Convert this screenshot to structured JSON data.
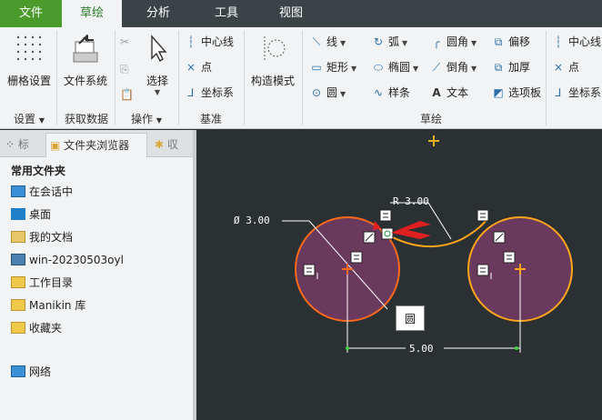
{
  "tabs": {
    "file": "文件",
    "sketch": "草绘",
    "analysis": "分析",
    "tools": "工具",
    "view": "视图"
  },
  "ribbon": {
    "grid_settings": "栅格设置",
    "file_system": "文件系统",
    "select": "选择",
    "centerline": "中心线",
    "point": "点",
    "coord_sys": "坐标系",
    "construct_mode": "构造模式",
    "line": "线",
    "rectangle": "矩形",
    "circle": "圆",
    "arc": "弧",
    "ellipse": "椭圆",
    "spline": "样条",
    "fillet": "圆角",
    "chamfer": "倒角",
    "text": "文本",
    "offset": "偏移",
    "thicken": "加厚",
    "palette": "选项板",
    "centerline2": "中心线",
    "point2": "点",
    "coord_sys2": "坐标系",
    "groups": {
      "settings": "设置",
      "get_data": "获取数据",
      "operations": "操作",
      "datum": "基准",
      "sketch": "草绘"
    }
  },
  "left_panel": {
    "tab_model": "标",
    "tab_folder": "文件夹浏览器",
    "tab_fav": "収",
    "section_title": "常用文件夹",
    "items": [
      "在会话中",
      "桌面",
      "我的文档",
      "win-20230503oyl",
      "工作目录",
      "Manikin 库",
      "收藏夹"
    ],
    "network": "网络"
  },
  "canvas": {
    "dim_diameter": "Ø 3.00",
    "dim_radius": "R 3.00",
    "dim_distance": "5.00",
    "tooltip": "圆",
    "colors": {
      "background": "#2b3033",
      "circle_fill": "#6a3a5e",
      "circle_stroke": "#ff8c1a",
      "dimension": "#ffffff",
      "center": "#ff8c1a",
      "arrow": "#e02020"
    }
  }
}
